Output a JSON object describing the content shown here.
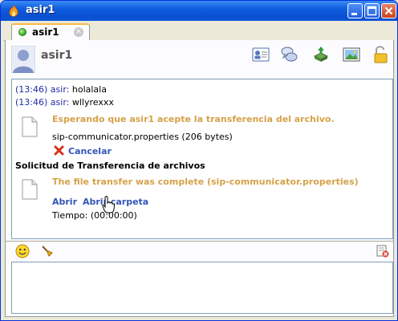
{
  "window": {
    "title": "asir1"
  },
  "tab": {
    "label": "asir1",
    "close_symbol": "×",
    "status": "online"
  },
  "header": {
    "contact_name": "asir1"
  },
  "toolbar_icons": [
    "contact-card-icon",
    "chat-bubbles-icon",
    "send-file-icon",
    "image-icon",
    "lock-icon"
  ],
  "messages": [
    {
      "time": "(13:46)",
      "sender": "asir:",
      "text": "holalala"
    },
    {
      "time": "(13:46)",
      "sender": "asir:",
      "text": "wllyrexxx"
    }
  ],
  "transfer1": {
    "status": "Esperando que asir1 acepte la transferencia del archivo.",
    "filename": "sip-communicator.properties (206 bytes)",
    "cancel_label": "Cancelar"
  },
  "transfer2": {
    "heading": "Solicitud de Transferencia de archivos",
    "status": "The file transfer was complete (sip-communicator.properties)",
    "open_label": "Abrir",
    "open_folder_label": "Abrir carpeta",
    "time_label": "Tiempo: (00:00:00)"
  },
  "editor_toolbar": {
    "icons": [
      "smiley-icon",
      "brush-icon",
      "clear-history-icon"
    ]
  },
  "input": {
    "value": ""
  },
  "colors": {
    "titlebar": "#0a4fcf",
    "link": "#3356b8",
    "status_text": "#d5a24a",
    "timestamp": "#1e2aa5"
  }
}
